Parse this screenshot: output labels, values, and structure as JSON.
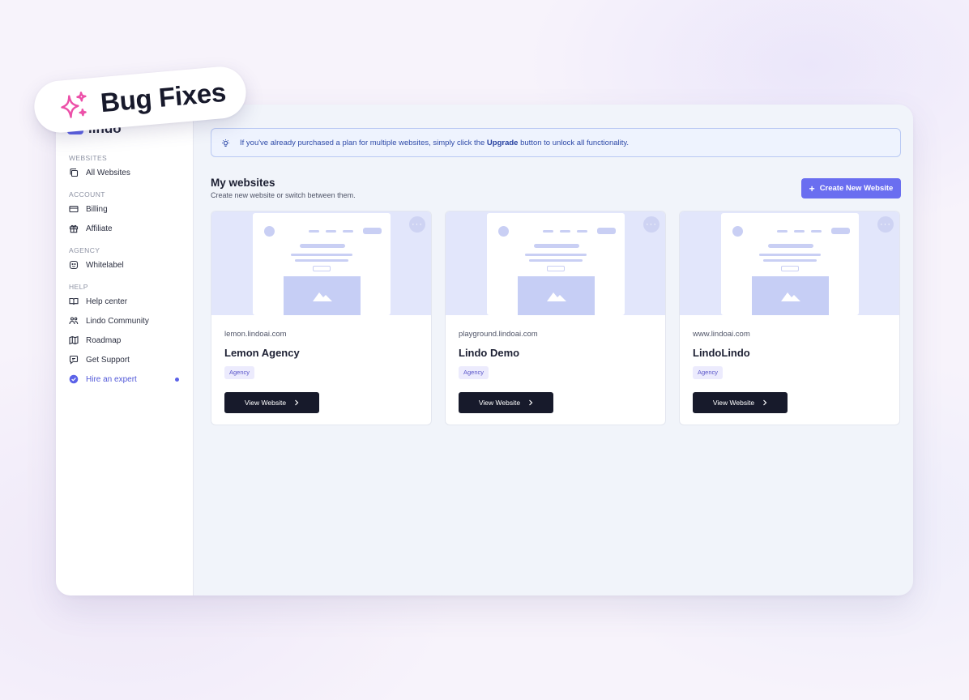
{
  "badge": {
    "label": "Bug Fixes",
    "icon": "sparkles-icon",
    "icon_color": "#ec4fa8"
  },
  "brand": {
    "name": "lindo",
    "color": "#5b62e8"
  },
  "sidebar": {
    "sections": [
      {
        "title": "WEBSITES",
        "items": [
          {
            "label": "All Websites",
            "icon": "copy-icon"
          }
        ]
      },
      {
        "title": "ACCOUNT",
        "items": [
          {
            "label": "Billing",
            "icon": "credit-card-icon"
          },
          {
            "label": "Affiliate",
            "icon": "gift-icon"
          }
        ]
      },
      {
        "title": "AGENCY",
        "items": [
          {
            "label": "Whitelabel",
            "icon": "face-icon"
          }
        ]
      },
      {
        "title": "HELP",
        "items": [
          {
            "label": "Help center",
            "icon": "book-icon"
          },
          {
            "label": "Lindo Community",
            "icon": "users-icon"
          },
          {
            "label": "Roadmap",
            "icon": "map-icon"
          },
          {
            "label": "Get Support",
            "icon": "chat-icon"
          },
          {
            "label": "Hire an expert",
            "icon": "verified-icon",
            "highlight": true
          }
        ]
      }
    ]
  },
  "notice": {
    "icon": "lightbulb-icon",
    "text_before": "If you've already purchased a plan for multiple websites, simply click the",
    "highlight": "Upgrade",
    "text_after": "button to unlock all functionality."
  },
  "main": {
    "title": "My websites",
    "subtitle": "Create new website or switch between them.",
    "create_button": "Create New Website",
    "accent": "#6a6ef0"
  },
  "websites": [
    {
      "url": "lemon.lindoai.com",
      "name": "Lemon Agency",
      "tag": "Agency",
      "button": "View Website"
    },
    {
      "url": "playground.lindoai.com",
      "name": "Lindo Demo",
      "tag": "Agency",
      "button": "View Website"
    },
    {
      "url": "www.lindoai.com",
      "name": "LindoLindo",
      "tag": "Agency",
      "button": "View Website"
    }
  ]
}
